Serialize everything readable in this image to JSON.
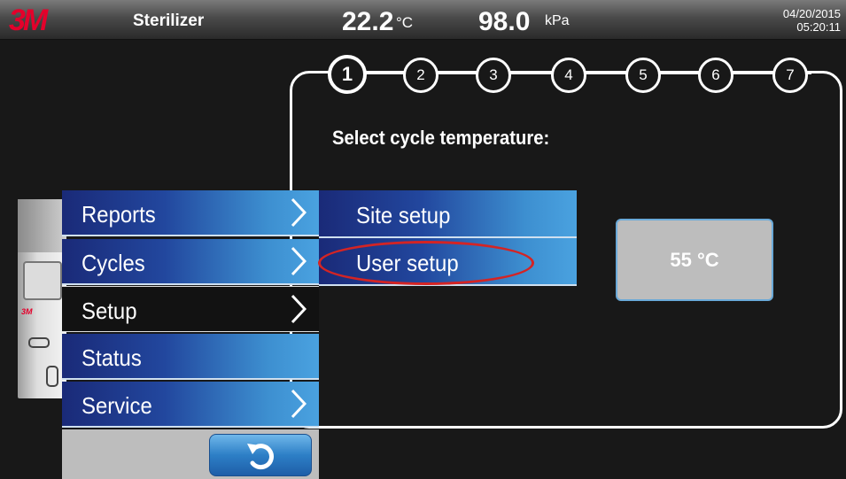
{
  "header": {
    "logo": "3M",
    "title": "Sterilizer",
    "temperature": "22.2",
    "temperature_unit": "°C",
    "pressure": "98.0",
    "pressure_unit": "kPa",
    "date": "04/20/2015",
    "time": "05:20:11"
  },
  "wizard": {
    "steps": [
      "1",
      "2",
      "3",
      "4",
      "5",
      "6",
      "7"
    ],
    "active_step": "1",
    "prompt": "Select cycle temperature:",
    "option": "55 °C"
  },
  "device": {
    "brand": "3M"
  },
  "menu": {
    "items": [
      {
        "label": "Reports",
        "has_arrow": true,
        "selected": false
      },
      {
        "label": "Cycles",
        "has_arrow": true,
        "selected": false
      },
      {
        "label": "Setup",
        "has_arrow": true,
        "selected": true
      },
      {
        "label": "Status",
        "has_arrow": false,
        "selected": false
      },
      {
        "label": "Service",
        "has_arrow": true,
        "selected": false
      }
    ]
  },
  "submenu": {
    "items": [
      {
        "label": "Site setup"
      },
      {
        "label": "User setup",
        "highlighted": true
      }
    ]
  },
  "colors": {
    "brand_red": "#e4002b",
    "menu_blue_dark": "#1a2a78",
    "menu_blue_light": "#4aa2e0",
    "highlight_oval": "#d42424",
    "option_bg": "#bdbdbd"
  }
}
